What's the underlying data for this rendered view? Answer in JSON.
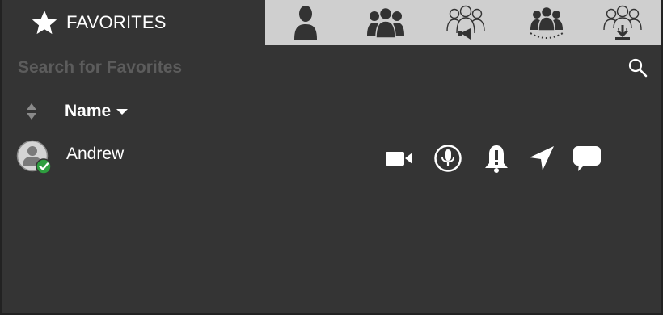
{
  "tabs": {
    "active_label": "FAVORITES",
    "items": [
      {
        "icon": "contact-icon"
      },
      {
        "icon": "group-icon"
      },
      {
        "icon": "broadcast-group-icon"
      },
      {
        "icon": "dynamic-group-icon"
      },
      {
        "icon": "download-group-icon"
      }
    ]
  },
  "search": {
    "placeholder": "Search for Favorites",
    "value": ""
  },
  "list": {
    "header_name": "Name",
    "contacts": [
      {
        "name": "Andrew",
        "status": "online",
        "actions": [
          "video-call-icon",
          "ptt-call-icon",
          "alert-icon",
          "location-icon",
          "message-icon"
        ]
      }
    ]
  },
  "colors": {
    "panel": "#343434",
    "tabbar": "#cfcfcf",
    "online": "#2e9e3f",
    "placeholder": "#5c5c5c"
  }
}
